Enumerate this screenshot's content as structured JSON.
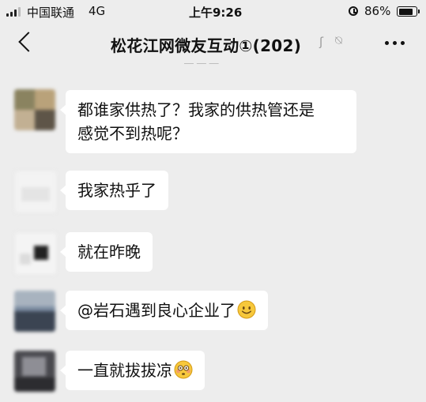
{
  "status_bar": {
    "carrier": "中国联通",
    "network": "4G",
    "time": "上午9:26",
    "battery": "86%",
    "battery_level": 0.86
  },
  "nav": {
    "title": "松花江网微友互动①(202)",
    "icons": [
      "back-icon",
      "ear-icon",
      "mute-icon",
      "more-icon"
    ]
  },
  "messages": [
    {
      "text": "都谁家供热了？我家的供热管还是感觉不到热呢？",
      "line1": "都谁家供热了？我家的供热管还是",
      "line2": "感觉不到热呢？",
      "avatar_colors": [
        "#8a8360",
        "#b9a27a",
        "#5e5548",
        "#c2b093"
      ]
    },
    {
      "text": "我家热乎了",
      "avatar_colors": [
        "#f3f3f3",
        "#e4e4e4"
      ]
    },
    {
      "text": "就在昨晚",
      "avatar_colors": [
        "#f2f2f2",
        "#222222"
      ]
    },
    {
      "text": "@岩石遇到良心企业了",
      "emoji": "smile-emoji",
      "avatar_colors": [
        "#7d8ea3",
        "#3b4452",
        "#a8b3bf"
      ]
    },
    {
      "text": "一直就拔拔凉",
      "emoji": "flushed-emoji",
      "avatar_colors": [
        "#4a4a4f",
        "#8e8e95",
        "#2c2c30"
      ]
    }
  ]
}
